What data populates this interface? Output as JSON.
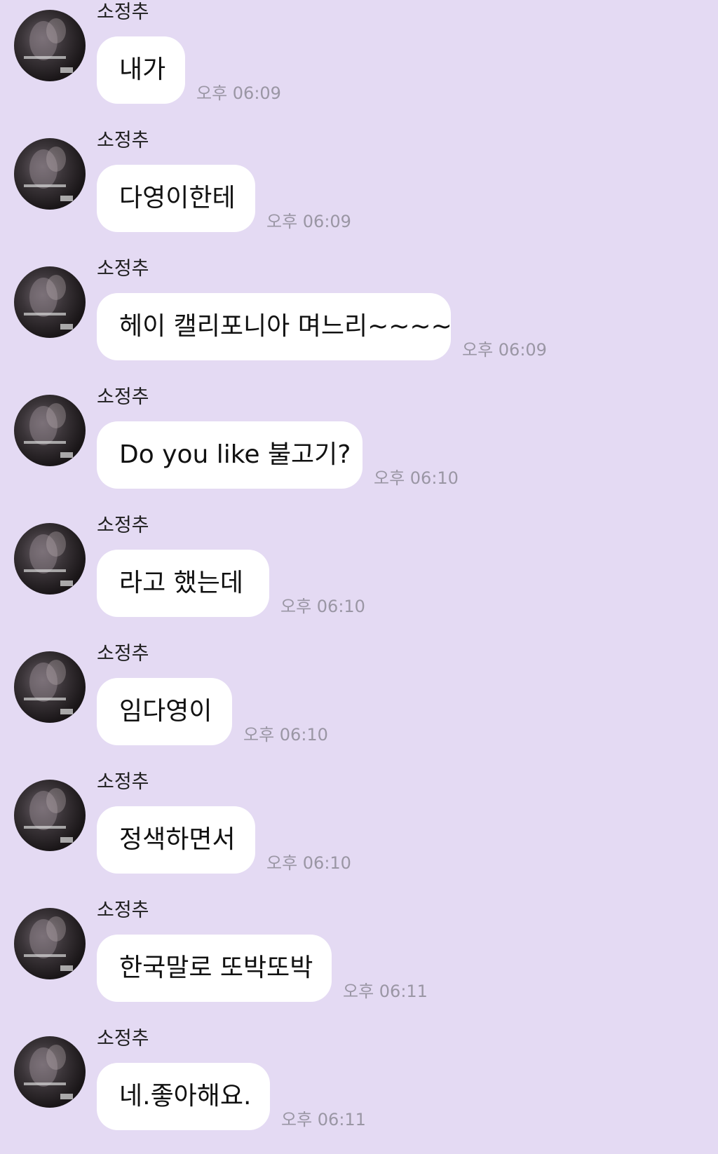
{
  "chat": {
    "background_color": "#e4daf3",
    "messages": [
      {
        "sender": "소정추",
        "text": "내가",
        "time": "오후 06:09"
      },
      {
        "sender": "소정추",
        "text": "다영이한테",
        "time": "오후 06:09"
      },
      {
        "sender": "소정추",
        "text": "헤이 캘리포니아 며느리~~~~",
        "time": "오후 06:09"
      },
      {
        "sender": "소정추",
        "text": "Do you like 불고기?",
        "time": "오후 06:10"
      },
      {
        "sender": "소정추",
        "text": "라고 했는데",
        "time": "오후 06:10"
      },
      {
        "sender": "소정추",
        "text": "임다영이",
        "time": "오후 06:10"
      },
      {
        "sender": "소정추",
        "text": "정색하면서",
        "time": "오후 06:10"
      },
      {
        "sender": "소정추",
        "text": "한국말로 또박또박",
        "time": "오후 06:11"
      },
      {
        "sender": "소정추",
        "text": "네.좋아해요.",
        "time": "오후 06:11"
      }
    ]
  }
}
